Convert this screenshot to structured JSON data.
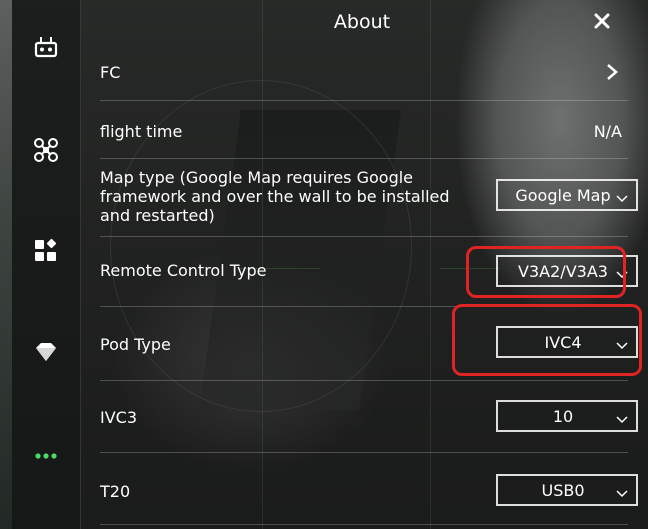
{
  "title": "About",
  "rail": {
    "items": [
      "remote-controller-icon",
      "drone-icon",
      "apps-icon",
      "diamond-icon",
      "more-icon"
    ],
    "active_color": "#4cd964"
  },
  "rows": {
    "fc": {
      "label": "FC"
    },
    "flight_time": {
      "label": "flight time",
      "value": "N/A"
    },
    "map_type": {
      "label": "Map type (Google Map requires Google framework and over the wall to be installed and restarted)",
      "value": "Google Map"
    },
    "rc_type": {
      "label": "Remote Control Type",
      "value": "V3A2/V3A3"
    },
    "pod_type": {
      "label": "Pod Type",
      "value": "IVC4"
    },
    "ivc3": {
      "label": "IVC3",
      "value": "10"
    },
    "t20": {
      "label": "T20",
      "value": "USB0"
    }
  },
  "highlight_color": "#e02424"
}
